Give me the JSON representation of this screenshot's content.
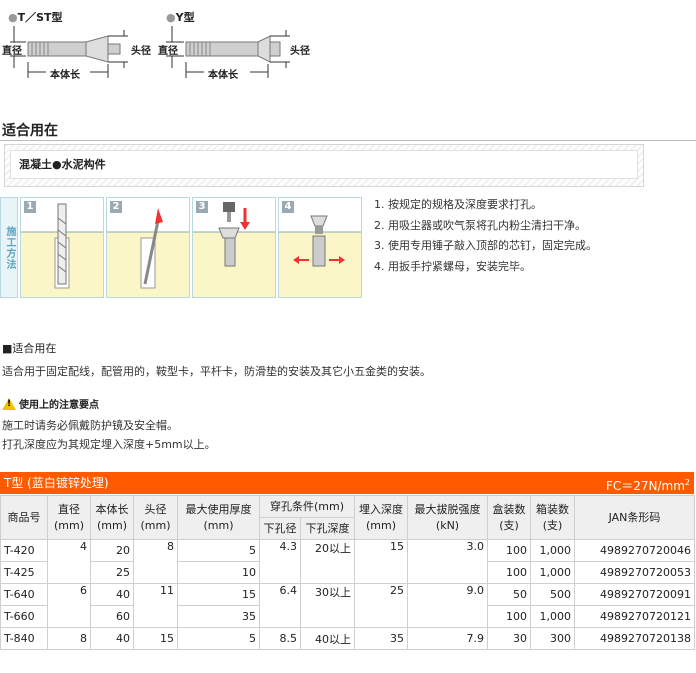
{
  "diagrams": {
    "left_title": "T／ST型",
    "right_title": "Y型",
    "diameter": "直径",
    "head_diameter": "头径",
    "body_length": "本体长"
  },
  "usage_title": "适合用在",
  "material_box": "混凝土●水泥构件",
  "construction_tab": "施工方法",
  "steps": [
    "1. 按规定的规格及深度要求打孔。",
    "2. 用吸尘器或吹气泵将孔内粉尘清扫干净。",
    "3. 使用专用锤子敲入顶部的芯钉，固定完成。",
    "4. 用扳手拧紧螺母，安装完毕。"
  ],
  "step_nums": [
    "1",
    "2",
    "3",
    "4"
  ],
  "usage2_title": "■适合用在",
  "usage2_text": "适合用于固定配线，配管用的，鞍型卡，平杆卡，防滑垫的安装及其它小五金类的安装。",
  "caution_title": "使用上的注意要点",
  "caution_icon_text": "!",
  "caution_lines": [
    "施工时请务必佩戴防护镜及安全帽。",
    "打孔深度应为其规定埋入深度+5mm以上。"
  ],
  "table": {
    "title": "T型 (蓝白镀锌处理)",
    "fc": "FC＝27N/mm",
    "fc_sup": "2",
    "headers": {
      "code": "商品号",
      "dia": "直径\n(mm)",
      "len": "本体长\n(mm)",
      "head": "头径\n(mm)",
      "thick": "最大使用厚度\n(mm)",
      "hole": "穿孔条件(mm)",
      "hole_dia": "下孔径",
      "hole_depth": "下孔深度",
      "embed": "埋入深度\n(mm)",
      "pull": "最大拔脱强度\n(kN)",
      "box": "盒装数\n(支)",
      "case": "箱装数\n(支)",
      "jan": "JAN条形码"
    },
    "rows": [
      {
        "code": "T-420",
        "dia": "4",
        "len": "20",
        "head": "8",
        "thick": "5",
        "hole_dia": "4.3",
        "hole_depth": "20以上",
        "embed": "15",
        "pull": "3.0",
        "box": "100",
        "case": "1,000",
        "jan": "4989270720046"
      },
      {
        "code": "T-425",
        "dia": "",
        "len": "25",
        "head": "",
        "thick": "10",
        "hole_dia": "",
        "hole_depth": "",
        "embed": "",
        "pull": "",
        "box": "100",
        "case": "1,000",
        "jan": "4989270720053"
      },
      {
        "code": "T-640",
        "dia": "6",
        "len": "40",
        "head": "11",
        "thick": "15",
        "hole_dia": "6.4",
        "hole_depth": "30以上",
        "embed": "25",
        "pull": "9.0",
        "box": "50",
        "case": "500",
        "jan": "4989270720091"
      },
      {
        "code": "T-660",
        "dia": "",
        "len": "60",
        "head": "",
        "thick": "35",
        "hole_dia": "",
        "hole_depth": "",
        "embed": "",
        "pull": "",
        "box": "100",
        "case": "1,000",
        "jan": "4989270720121"
      },
      {
        "code": "T-840",
        "dia": "8",
        "len": "40",
        "head": "15",
        "thick": "5",
        "hole_dia": "8.5",
        "hole_depth": "40以上",
        "embed": "35",
        "pull": "7.9",
        "box": "30",
        "case": "300",
        "jan": "4989270720138"
      }
    ]
  },
  "colors": {
    "accent": "#ff5a00",
    "tab_blue": "#5aa6c2"
  }
}
